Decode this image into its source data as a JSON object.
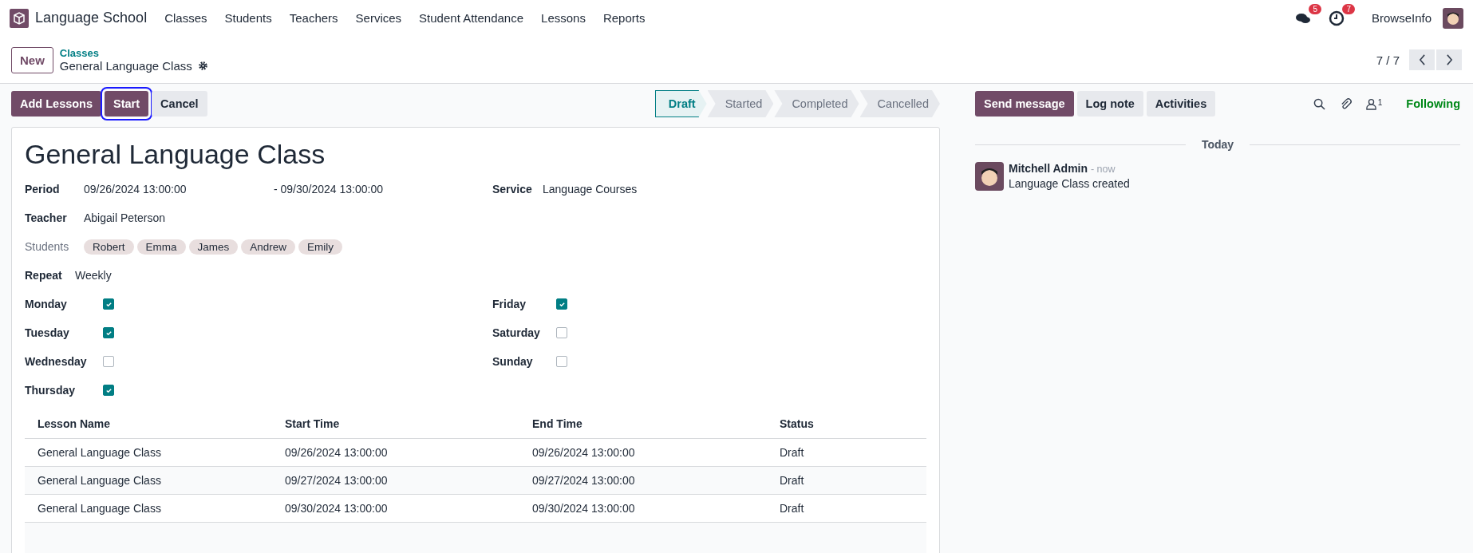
{
  "navbar": {
    "app_name": "Language School",
    "menu": [
      "Classes",
      "Students",
      "Teachers",
      "Services",
      "Student Attendance",
      "Lessons",
      "Reports"
    ],
    "messages_count": "5",
    "activities_count": "7",
    "company": "BrowseInfo"
  },
  "control_panel": {
    "new_button": "New",
    "breadcrumb_parent": "Classes",
    "breadcrumb_current": "General Language Class",
    "pager": "7 / 7"
  },
  "actions": [
    {
      "label": "Add Lessons",
      "kind": "primary",
      "focused": false
    },
    {
      "label": "Start",
      "kind": "primary",
      "focused": true
    },
    {
      "label": "Cancel",
      "kind": "secondary",
      "focused": false
    }
  ],
  "statusbar": [
    {
      "label": "Draft",
      "selected": true
    },
    {
      "label": "Started",
      "selected": false
    },
    {
      "label": "Completed",
      "selected": false
    },
    {
      "label": "Cancelled",
      "selected": false
    }
  ],
  "form": {
    "title": "General Language Class",
    "period_label": "Period",
    "period_start": "09/26/2024 13:00:00",
    "period_end": "- 09/30/2024 13:00:00",
    "service_label": "Service",
    "service": "Language Courses",
    "teacher_label": "Teacher",
    "teacher": "Abigail Peterson",
    "students_label": "Students",
    "students": [
      "Robert",
      "Emma",
      "James",
      "Andrew",
      "Emily"
    ],
    "repeat_label": "Repeat",
    "repeat": "Weekly",
    "days_left": [
      {
        "label": "Monday",
        "checked": true
      },
      {
        "label": "Tuesday",
        "checked": true
      },
      {
        "label": "Wednesday",
        "checked": false
      },
      {
        "label": "Thursday",
        "checked": true
      }
    ],
    "days_right": [
      {
        "label": "Friday",
        "checked": true
      },
      {
        "label": "Saturday",
        "checked": false
      },
      {
        "label": "Sunday",
        "checked": false
      }
    ]
  },
  "table": {
    "columns": [
      "Lesson Name",
      "Start Time",
      "End Time",
      "Status"
    ],
    "rows": [
      [
        "General Language Class",
        "09/26/2024 13:00:00",
        "09/26/2024 13:00:00",
        "Draft"
      ],
      [
        "General Language Class",
        "09/27/2024 13:00:00",
        "09/27/2024 13:00:00",
        "Draft"
      ],
      [
        "General Language Class",
        "09/30/2024 13:00:00",
        "09/30/2024 13:00:00",
        "Draft"
      ]
    ]
  },
  "chatter": {
    "buttons": [
      {
        "label": "Send message",
        "kind": "primary"
      },
      {
        "label": "Log note",
        "kind": "secondary"
      },
      {
        "label": "Activities",
        "kind": "secondary"
      }
    ],
    "followers_count": "1",
    "following": "Following",
    "date_separator": "Today",
    "messages": [
      {
        "author": "Mitchell Admin",
        "time": "- now",
        "body": "Language Class created"
      }
    ]
  }
}
